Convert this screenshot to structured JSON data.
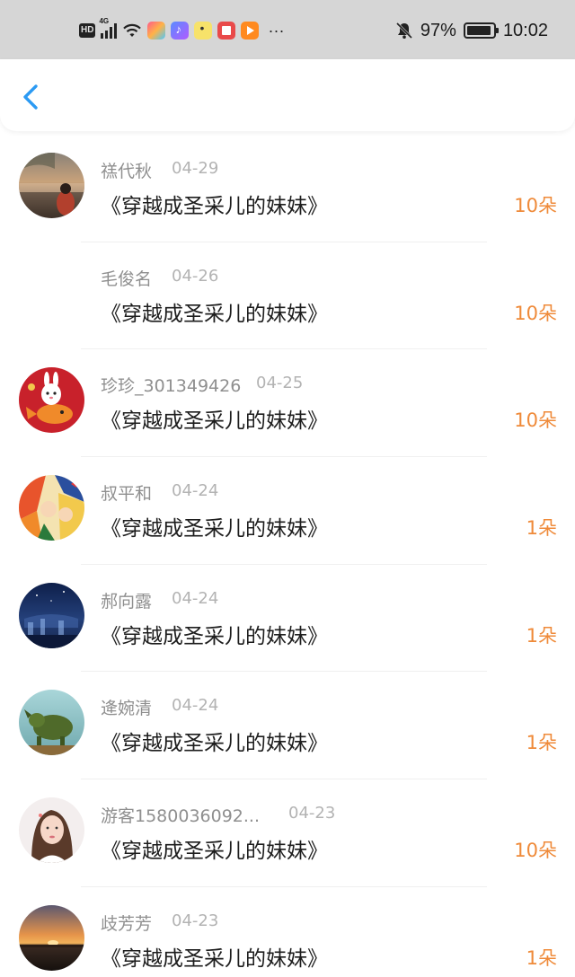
{
  "status_bar": {
    "hd_label": "HD",
    "network_label": "4G",
    "battery_percent": "97%",
    "time": "10:02",
    "more_icon": "···"
  },
  "nav": {
    "back_icon": "chevron-left-icon",
    "accent_color": "#2b9af3"
  },
  "colors": {
    "amount": "#ef8a39",
    "name": "#8f8f8f",
    "date": "#b3b3b3",
    "title": "#1d1d1d"
  },
  "gifts": [
    {
      "name": "禚代秋",
      "date": "04-29",
      "book": "《穿越成圣采儿的妹妹》",
      "amount": "10朵",
      "avatar": "lake-sunset-photo"
    },
    {
      "name": "毛俊名",
      "date": "04-26",
      "book": "《穿越成圣采儿的妹妹》",
      "amount": "10朵",
      "avatar": "none"
    },
    {
      "name": "珍珍_301349426",
      "date": "04-25",
      "book": "《穿越成圣采儿的妹妹》",
      "amount": "10朵",
      "avatar": "rabbit-fish-cartoon"
    },
    {
      "name": "叔平和",
      "date": "04-24",
      "book": "《穿越成圣采儿的妹妹》",
      "amount": "1朵",
      "avatar": "anime-characters"
    },
    {
      "name": "郝向露",
      "date": "04-24",
      "book": "《穿越成圣采儿的妹妹》",
      "amount": "1朵",
      "avatar": "night-city-photo"
    },
    {
      "name": "逄婉清",
      "date": "04-24",
      "book": "《穿越成圣采儿的妹妹》",
      "amount": "1朵",
      "avatar": "jade-sculpture-photo"
    },
    {
      "name": "游客1580036092...",
      "date": "04-23",
      "book": "《穿越成圣采儿的妹妹》",
      "amount": "10朵",
      "avatar": "woman-portrait-photo"
    },
    {
      "name": "歧芳芳",
      "date": "04-23",
      "book": "《穿越成圣采儿的妹妹》",
      "amount": "1朵",
      "avatar": "sea-sunset-photo"
    }
  ]
}
